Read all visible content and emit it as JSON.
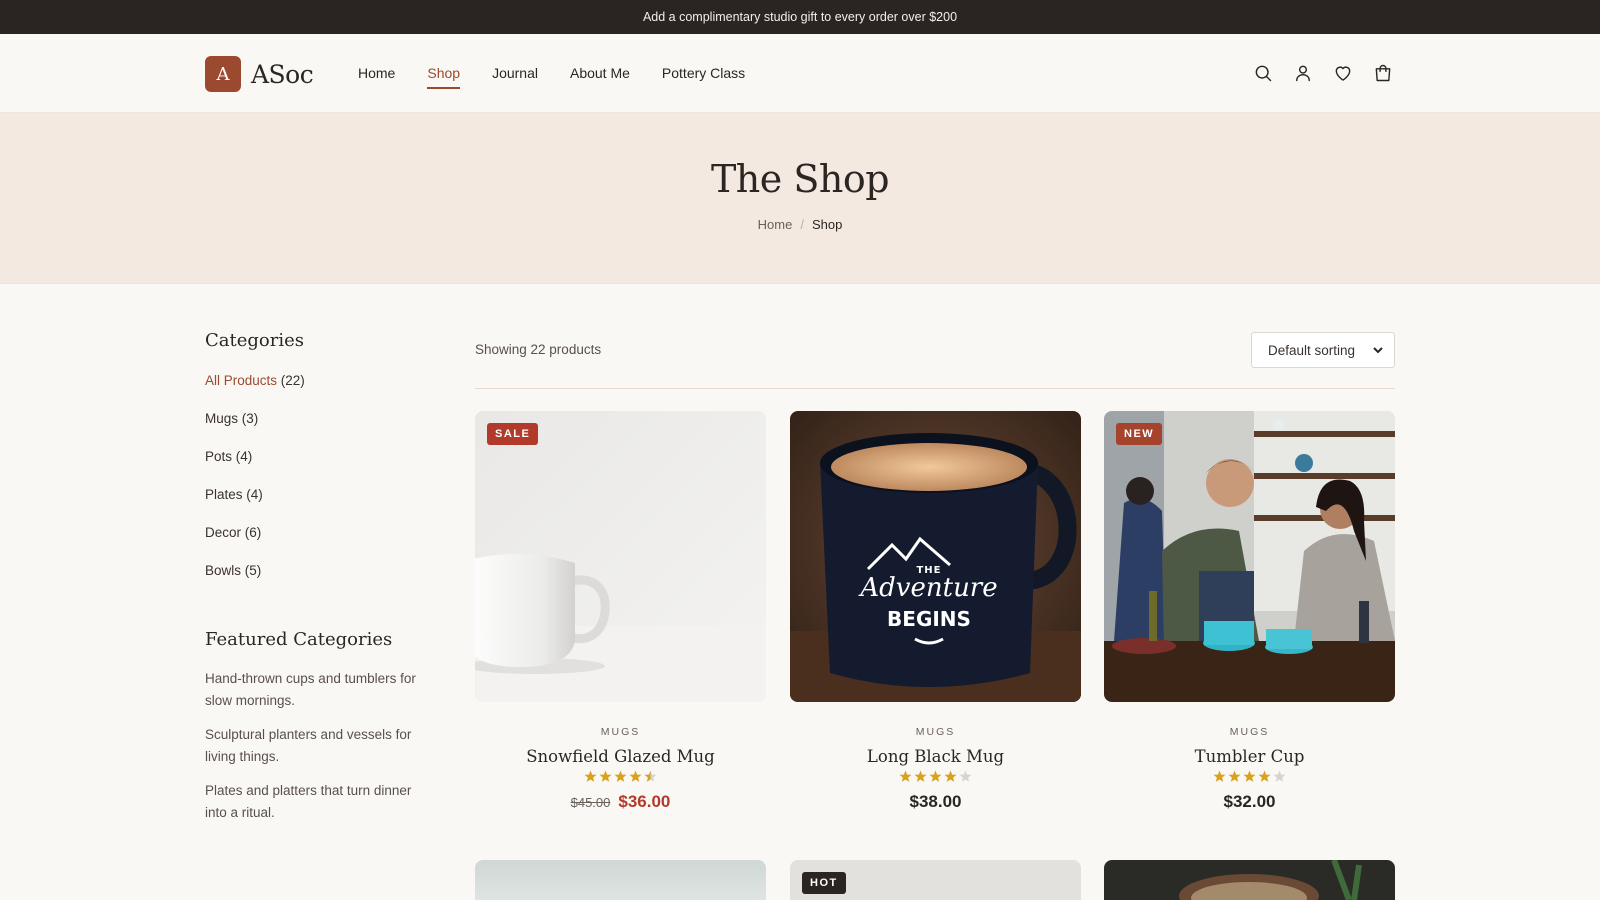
{
  "announcement": "Add a complimentary studio gift to every order over $200",
  "brand": {
    "letter": "A",
    "name": "ASoc"
  },
  "nav": [
    {
      "label": "Home",
      "active": false
    },
    {
      "label": "Shop",
      "active": true
    },
    {
      "label": "Journal",
      "active": false
    },
    {
      "label": "About Me",
      "active": false
    },
    {
      "label": "Pottery Class",
      "active": false
    }
  ],
  "header_icons": [
    "search-icon",
    "user-icon",
    "heart-icon",
    "cart-icon"
  ],
  "hero": {
    "title": "The Shop",
    "breadcrumb": [
      "Home",
      "/",
      "Shop"
    ]
  },
  "sidebar": {
    "categories_title": "Categories",
    "categories": [
      {
        "name": "All Products",
        "count": "(22)",
        "active": true
      },
      {
        "name": "Mugs",
        "count": "(3)",
        "active": false
      },
      {
        "name": "Pots",
        "count": "(4)",
        "active": false
      },
      {
        "name": "Plates",
        "count": "(4)",
        "active": false
      },
      {
        "name": "Decor",
        "count": "(6)",
        "active": false
      },
      {
        "name": "Bowls",
        "count": "(5)",
        "active": false
      }
    ],
    "featured_title": "Featured Categories",
    "featured": [
      "Hand-thrown cups and tumblers for slow mornings.",
      "Sculptural planters and vessels for living things.",
      "Plates and platters that turn dinner into a ritual."
    ]
  },
  "toolbar": {
    "showing": "Showing 22 products",
    "sort_value": "Default sorting"
  },
  "products": [
    {
      "badge": "SALE",
      "category": "MUGS",
      "name": "Snowfield Glazed Mug",
      "rating": 4.5,
      "old_price": "$45.00",
      "price": "$36.00"
    },
    {
      "badge": "",
      "category": "MUGS",
      "name": "Long Black Mug",
      "rating": 4,
      "old_price": "",
      "price": "$38.00",
      "mug_print": [
        "THE",
        "Adventure",
        "BEGINS"
      ]
    },
    {
      "badge": "NEW",
      "category": "MUGS",
      "name": "Tumbler Cup",
      "rating": 4,
      "old_price": "",
      "price": "$32.00"
    },
    {
      "badge": ""
    },
    {
      "badge": "HOT"
    },
    {
      "badge": ""
    }
  ],
  "colors": {
    "accent": "#9b4a2f",
    "sale": "#b23a2a",
    "star": "#d9a11e",
    "dark": "#2a2523",
    "hero_bg": "#f3e9e1"
  }
}
